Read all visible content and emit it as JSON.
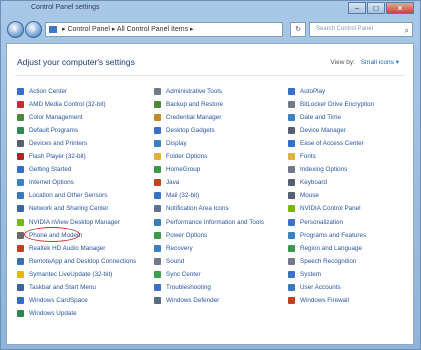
{
  "window": {
    "title": "Control Panel settings",
    "buttons": [
      "–",
      "□",
      "✕"
    ]
  },
  "nav": {
    "back": "‹",
    "forward": "›",
    "address": "▸ Control Panel ▸ All Control Panel Items ▸",
    "refresh": "↻",
    "search_placeholder": "Search Control Panel"
  },
  "main": {
    "heading": "Adjust your computer's settings",
    "view_by_label": "View by:",
    "view_by_value": "Small icons ▾"
  },
  "columns": [
    [
      {
        "label": "Action Center",
        "color": "#3a70c8"
      },
      {
        "label": "AMD Media Control (32-bit)",
        "color": "#c03030"
      },
      {
        "label": "Color Management",
        "color": "#4a8a3a"
      },
      {
        "label": "Default Programs",
        "color": "#2e8b57"
      },
      {
        "label": "Devices and Printers",
        "color": "#555f70"
      },
      {
        "label": "Flash Player (32-bit)",
        "color": "#b22222"
      },
      {
        "label": "Getting Started",
        "color": "#2f6fcf"
      },
      {
        "label": "Internet Options",
        "color": "#3b82c4"
      },
      {
        "label": "Location and Other Sensors",
        "color": "#3a7ab8"
      },
      {
        "label": "Network and Sharing Center",
        "color": "#356aa8"
      },
      {
        "label": "NVIDIA nView Desktop Manager",
        "color": "#76b900"
      },
      {
        "label": "Phone and Modem",
        "color": "#6a6a6a"
      },
      {
        "label": "Realtek HD Audio Manager",
        "color": "#c04020"
      },
      {
        "label": "RemoteApp and Desktop Connections",
        "color": "#3a6fb0"
      },
      {
        "label": "Symantec LiveUpdate (32-bit)",
        "color": "#e6b800"
      },
      {
        "label": "Taskbar and Start Menu",
        "color": "#4060a0"
      },
      {
        "label": "Windows CardSpace",
        "color": "#3070c0"
      },
      {
        "label": "Windows Update",
        "color": "#2a8a4a"
      }
    ],
    [
      {
        "label": "Administrative Tools",
        "color": "#707a88"
      },
      {
        "label": "Backup and Restore",
        "color": "#4a8a3a"
      },
      {
        "label": "Credential Manager",
        "color": "#c08a30"
      },
      {
        "label": "Desktop Gadgets",
        "color": "#3a70c8"
      },
      {
        "label": "Display",
        "color": "#3b82c4"
      },
      {
        "label": "Folder Options",
        "color": "#e0b040"
      },
      {
        "label": "HomeGroup",
        "color": "#3a9a4a"
      },
      {
        "label": "Java",
        "color": "#c04020"
      },
      {
        "label": "Mail (32-bit)",
        "color": "#3a70c8"
      },
      {
        "label": "Notification Area Icons",
        "color": "#607090"
      },
      {
        "label": "Performance Information and Tools",
        "color": "#3a7ab8"
      },
      {
        "label": "Power Options",
        "color": "#3a9a4a"
      },
      {
        "label": "Recovery",
        "color": "#3b82c4"
      },
      {
        "label": "Sound",
        "color": "#707a88"
      },
      {
        "label": "Sync Center",
        "color": "#3aa04a"
      },
      {
        "label": "Troubleshooting",
        "color": "#3a70c8"
      },
      {
        "label": "Windows Defender",
        "color": "#5a6a80"
      }
    ],
    [
      {
        "label": "AutoPlay",
        "color": "#3a70c8"
      },
      {
        "label": "BitLocker Drive Encryption",
        "color": "#707a88"
      },
      {
        "label": "Date and Time",
        "color": "#3b82c4"
      },
      {
        "label": "Device Manager",
        "color": "#555f70"
      },
      {
        "label": "Ease of Access Center",
        "color": "#2f6fcf"
      },
      {
        "label": "Fonts",
        "color": "#e0b040"
      },
      {
        "label": "Indexing Options",
        "color": "#707a88"
      },
      {
        "label": "Keyboard",
        "color": "#555f70"
      },
      {
        "label": "Mouse",
        "color": "#555f70"
      },
      {
        "label": "NVIDIA Control Panel",
        "color": "#76b900"
      },
      {
        "label": "Personalization",
        "color": "#3a70c8"
      },
      {
        "label": "Programs and Features",
        "color": "#3b82c4"
      },
      {
        "label": "Region and Language",
        "color": "#3a9a4a"
      },
      {
        "label": "Speech Recognition",
        "color": "#707a88"
      },
      {
        "label": "System",
        "color": "#3a70c8"
      },
      {
        "label": "User Accounts",
        "color": "#3a7ab8"
      },
      {
        "label": "Windows Firewall",
        "color": "#c04020"
      }
    ]
  ]
}
